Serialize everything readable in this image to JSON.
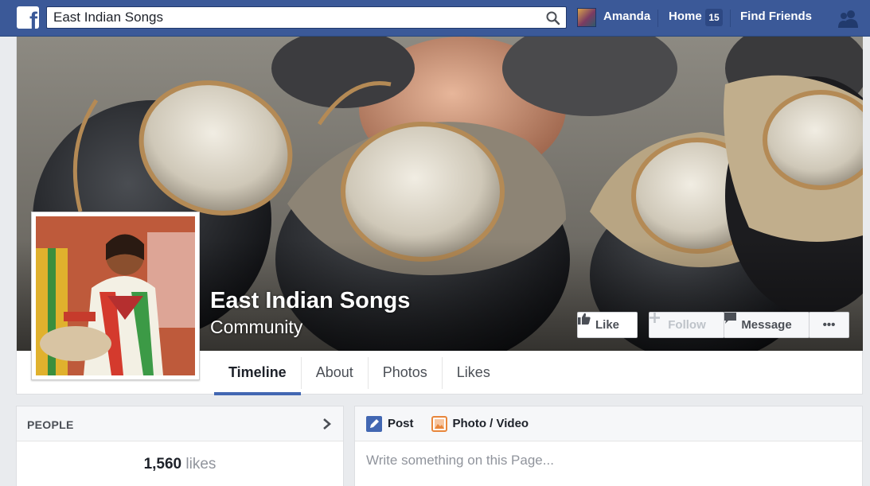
{
  "topbar": {
    "search": {
      "value": "East Indian Songs"
    },
    "user_name": "Amanda",
    "home_label": "Home",
    "home_count": "15",
    "find_friends_label": "Find Friends",
    "logo_letter": "f"
  },
  "page": {
    "title": "East Indian Songs",
    "category": "Community"
  },
  "actions": {
    "like_label": "Like",
    "follow_label": "Follow",
    "message_label": "Message",
    "more_label": "•••"
  },
  "tabs": [
    {
      "label": "Timeline",
      "active": true
    },
    {
      "label": "About",
      "active": false
    },
    {
      "label": "Photos",
      "active": false
    },
    {
      "label": "Likes",
      "active": false
    }
  ],
  "people": {
    "title": "PEOPLE",
    "likes_count": "1,560",
    "likes_word": "likes"
  },
  "composer": {
    "post_label": "Post",
    "photo_label": "Photo / Video",
    "placeholder": "Write something on this Page..."
  },
  "colors": {
    "brand_blue": "#3b5998",
    "tab_underline": "#4267b2",
    "background": "#e9ebee"
  },
  "icons": [
    "facebook-logo-icon",
    "search-icon",
    "friends-icon",
    "thumbs-up-icon",
    "plus-icon",
    "message-icon",
    "more-icon",
    "chevron-right-icon",
    "pencil-icon",
    "photo-icon"
  ]
}
